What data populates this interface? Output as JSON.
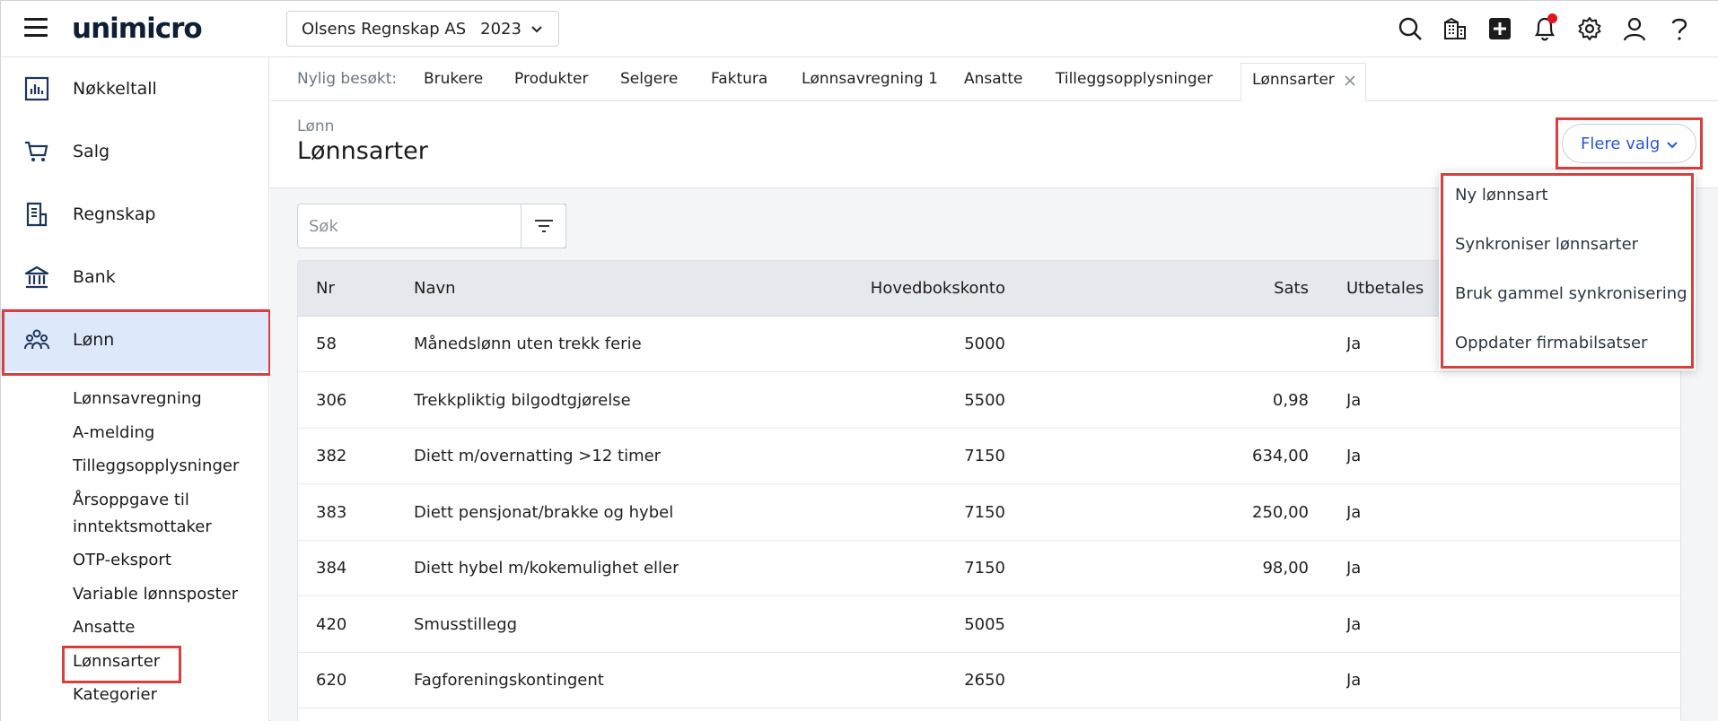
{
  "app": {
    "logo": "unimicro"
  },
  "company": {
    "name": "Olsens Regnskap AS",
    "year": "2023"
  },
  "top_icons": [
    "search-icon",
    "building-icon",
    "plus-square-icon",
    "bell-icon",
    "gear-icon",
    "user-icon",
    "help-icon"
  ],
  "sidebar": {
    "items": [
      {
        "label": "Nøkkeltall",
        "icon": "chart-icon"
      },
      {
        "label": "Salg",
        "icon": "cart-icon"
      },
      {
        "label": "Regnskap",
        "icon": "ledger-icon"
      },
      {
        "label": "Bank",
        "icon": "bank-icon"
      },
      {
        "label": "Lønn",
        "icon": "people-icon",
        "active": true
      }
    ],
    "sub_items": [
      "Lønnsavregning",
      "A-melding",
      "Tilleggsopplysninger",
      "Årsoppgave til",
      "inntektsmottaker",
      "OTP-eksport",
      "Variable lønnsposter",
      "Ansatte",
      "Lønnsarter",
      "Kategorier"
    ]
  },
  "recent": {
    "label": "Nylig besøkt:",
    "tabs": [
      "Brukere",
      "Produkter",
      "Selgere",
      "Faktura",
      "Lønnsavregning 1",
      "Ansatte",
      "Tilleggsopplysninger",
      "Lønnsarter"
    ]
  },
  "header": {
    "breadcrumb": "Lønn",
    "title": "Lønnsarter",
    "more_button": "Flere valg"
  },
  "search": {
    "placeholder": "Søk"
  },
  "table": {
    "columns": [
      "Nr",
      "Navn",
      "Hovedbokskonto",
      "Sats",
      "Utbetales"
    ],
    "rows": [
      {
        "nr": "58",
        "navn": "Månedslønn uten trekk ferie",
        "konto": "5000",
        "sats": "",
        "utbetales": "Ja"
      },
      {
        "nr": "306",
        "navn": "Trekkpliktig bilgodtgjørelse",
        "konto": "5500",
        "sats": "0,98",
        "utbetales": "Ja"
      },
      {
        "nr": "382",
        "navn": "Diett m/overnatting >12 timer",
        "konto": "7150",
        "sats": "634,00",
        "utbetales": "Ja"
      },
      {
        "nr": "383",
        "navn": "Diett pensjonat/brakke og hybel u/ko",
        "konto": "7150",
        "sats": "250,00",
        "utbetales": "Ja"
      },
      {
        "nr": "384",
        "navn": "Diett hybel m/kokemulighet eller priv",
        "konto": "7150",
        "sats": "98,00",
        "utbetales": "Ja"
      },
      {
        "nr": "420",
        "navn": "Smusstillegg",
        "konto": "5005",
        "sats": "",
        "utbetales": "Ja"
      },
      {
        "nr": "620",
        "navn": "Fagforeningskontingent",
        "konto": "2650",
        "sats": "",
        "utbetales": "Ja"
      }
    ]
  },
  "menu": {
    "items": [
      "Ny lønnsart",
      "Synkroniser lønnsarter",
      "Bruk gammel synkronisering",
      "Oppdater firmabilsatser"
    ]
  }
}
